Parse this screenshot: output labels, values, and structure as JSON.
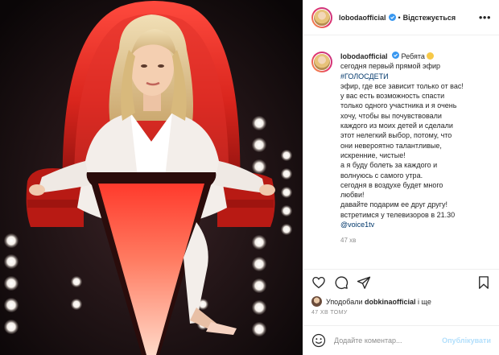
{
  "post": {
    "author": {
      "username": "lobodaofficial",
      "verified": true,
      "follow_label": "Відстежується",
      "avatar": "profile-avatar"
    },
    "header": {
      "separator": "•",
      "more_icon": "more-options-icon"
    },
    "caption": {
      "lines": [
        "Ребята",
        "сегодня первый прямой эфир",
        "#ГОЛОСДЕТИ",
        "эфир, где все зависит только от вас!",
        "у вас есть возможность спасти",
        "только одного участника и я очень",
        "хочу, чтобы вы почувствовали",
        "каждого из моих детей и сделали",
        "этот нелегкий выбор, потому, что",
        "они невероятно талантливые,",
        "искренние, чистые!",
        "а я буду болеть за каждого и",
        "волнуюсь с самого утра.",
        "сегодня в воздухе будет много",
        "любви!",
        "давайте подарим ее друг другу!",
        "встретимся у телевизоров в 21.30",
        "@voice1tv"
      ],
      "emoji": "smiling-face-emoji",
      "time": "47 хв"
    },
    "actions": {
      "like_icon": "heart-icon",
      "comment_icon": "comment-icon",
      "share_icon": "share-icon",
      "save_icon": "bookmark-icon"
    },
    "likes": {
      "prefix": "Уподобали",
      "user": "dobkinaofficial",
      "suffix": "і ще"
    },
    "time_ago": "47 ХВ ТОМУ",
    "comment": {
      "placeholder": "Додайте коментар...",
      "publish_label": "Опублікувати",
      "emoji_icon": "smiley-icon"
    },
    "colors": {
      "link": "#00376b",
      "secondary_text": "#8e8e8e",
      "publish_disabled": "#b2dffc",
      "verified": "#3897f0"
    }
  }
}
